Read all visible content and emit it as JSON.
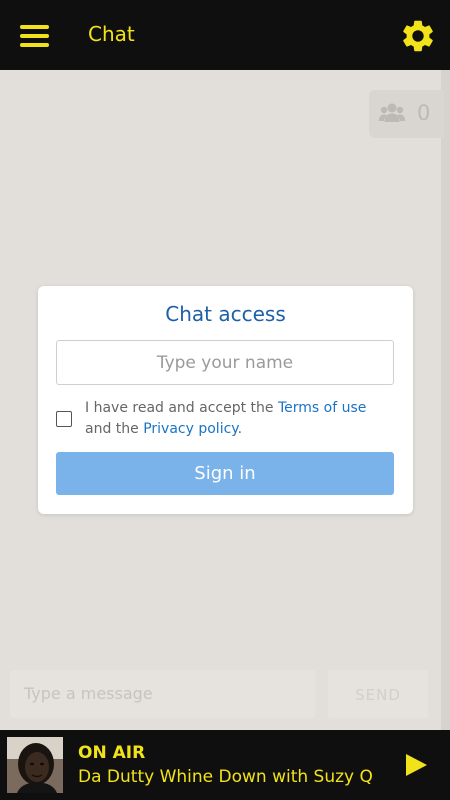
{
  "header": {
    "title": "Chat",
    "menu_icon": "hamburger-menu-icon",
    "settings_icon": "gear-icon"
  },
  "online": {
    "icon": "users-icon",
    "count": "0"
  },
  "modal": {
    "title": "Chat access",
    "name_placeholder": "Type your name",
    "terms_prefix": "I have read and accept the ",
    "terms_link": "Terms of use",
    "terms_middle": " and the ",
    "privacy_link": "Privacy policy",
    "terms_suffix": ".",
    "signin_label": "Sign in"
  },
  "composer": {
    "placeholder": "Type a message",
    "send_label": "SEND"
  },
  "player": {
    "status": "ON AIR",
    "show": "Da Dutty Whine Down with Suzy Q",
    "play_icon": "play-icon"
  },
  "colors": {
    "accent": "#f2e21a",
    "bar_background": "#0f0f0f",
    "link": "#1b73c6",
    "title": "#1d5fa8",
    "button": "#7ab2ea",
    "chat_background": "#e2dfdb"
  }
}
